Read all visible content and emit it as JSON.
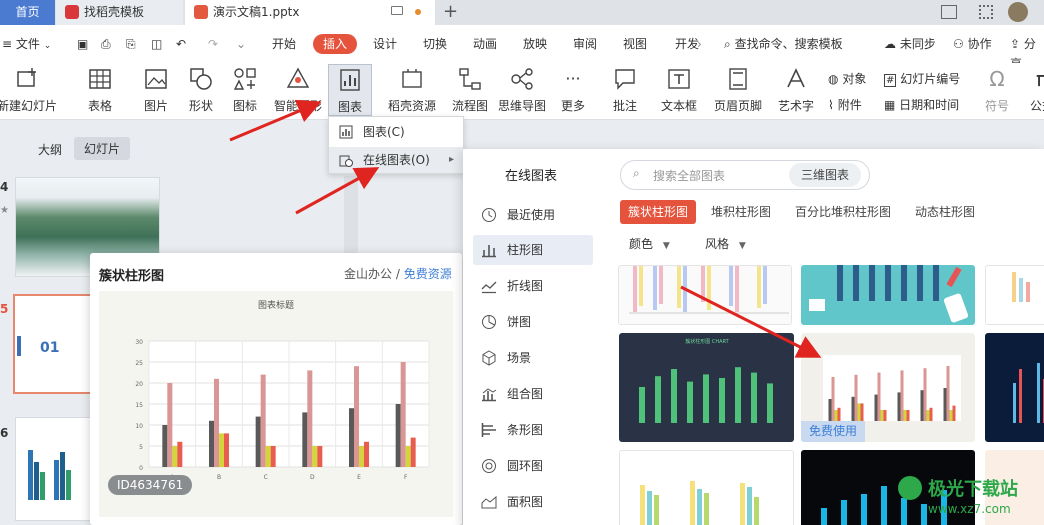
{
  "tabs": {
    "home": "首页",
    "find": "找稻壳模板",
    "file": "演示文稿1.pptx"
  },
  "menu": {
    "file": "文件",
    "items": [
      "开始",
      "插入",
      "设计",
      "切换",
      "动画",
      "放映",
      "审阅",
      "视图",
      "开发"
    ],
    "search": "查找命令、搜索模板",
    "sync": "未同步",
    "collab": "协作",
    "share": "分享"
  },
  "ribbon": {
    "new_slide": "新建幻灯片",
    "table": "表格",
    "image": "图片",
    "shape": "形状",
    "icon": "图标",
    "smartart": "智能图形",
    "chart": "图表",
    "shell": "稻壳资源",
    "flowchart": "流程图",
    "mindmap": "思维导图",
    "more": "更多",
    "comment": "批注",
    "textbox": "文本框",
    "header_footer": "页眉页脚",
    "wordart": "艺术字",
    "object": "对象",
    "attachment": "附件",
    "slide_number": "幻灯片编号",
    "datetime": "日期和时间",
    "symbol": "符号",
    "formula": "公式"
  },
  "left_panel": {
    "tab_outline": "大纲",
    "tab_slides": "幻灯片",
    "slide_numbers": [
      "4",
      "5",
      "6"
    ],
    "star": "★",
    "slide5_text": "01"
  },
  "dropdown": {
    "items": [
      "图表(C)",
      "在线图表(O)"
    ]
  },
  "preview": {
    "title": "簇状柱形图",
    "source": "金山办公",
    "separator": "/",
    "free_resource": "免费资源",
    "chart_title": "图表标题",
    "id_label": "ID4634761"
  },
  "chart_data": {
    "type": "bar",
    "title": "图表标题",
    "categories": [
      "A",
      "B",
      "C",
      "D",
      "E",
      "F"
    ],
    "ylim": [
      0,
      30
    ],
    "yticks": [
      0,
      5,
      10,
      15,
      20,
      25,
      30
    ],
    "series": [
      {
        "values": [
          10,
          11,
          12,
          13,
          14,
          15
        ],
        "color": "#595959"
      },
      {
        "values": [
          20,
          21,
          22,
          23,
          24,
          25
        ],
        "color": "#d99694"
      },
      {
        "values": [
          5,
          8,
          5,
          5,
          5,
          5
        ],
        "color": "#d4d43c"
      },
      {
        "values": [
          6,
          8,
          5,
          5,
          6,
          7
        ],
        "color": "#e85d50"
      }
    ]
  },
  "panel": {
    "title": "在线图表",
    "search_placeholder": "搜索全部图表",
    "three_d": "三维图表",
    "categories": [
      "最近使用",
      "柱形图",
      "折线图",
      "饼图",
      "场景",
      "组合图",
      "条形图",
      "圆环图",
      "面积图"
    ],
    "filter_tabs": [
      "簇状柱形图",
      "堆积柱形图",
      "百分比堆积柱形图",
      "动态柱形图"
    ],
    "color_label": "颜色",
    "style_label": "风格",
    "free_use": "免费使用",
    "dark_card_title": "簇状柱形图 CHART"
  },
  "watermark": {
    "name": "极光下载站",
    "url": "www.xz7.com"
  },
  "colors": {
    "accent": "#e6533c",
    "brand_blue": "#4a7bd0",
    "link": "#3d7fd6",
    "arrow": "#e0241f"
  }
}
